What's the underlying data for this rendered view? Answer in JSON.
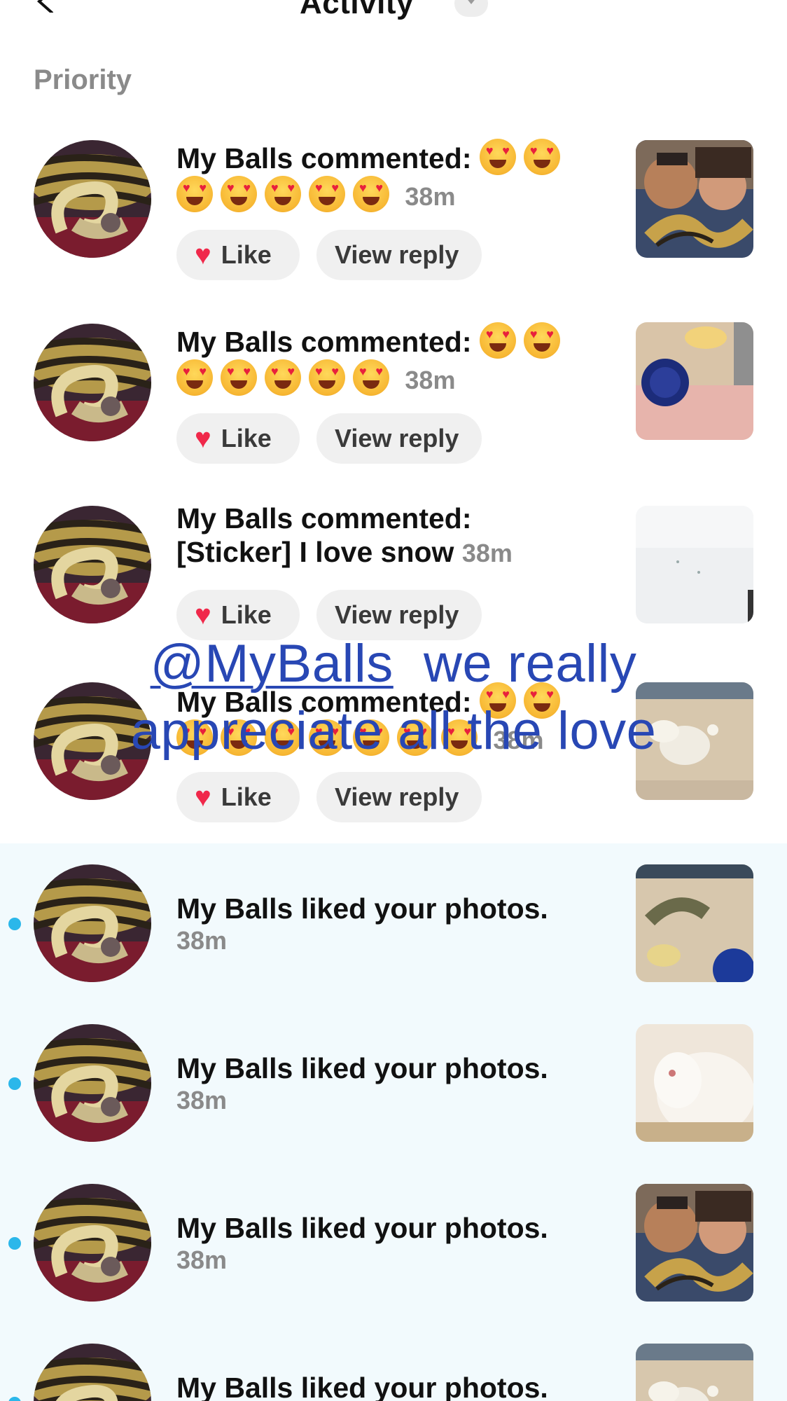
{
  "header": {
    "title": "Activity"
  },
  "section": {
    "label": "Priority"
  },
  "comments": [
    {
      "author": "My Balls",
      "prefix": "My Balls commented:",
      "emoji_count_line1": 2,
      "emoji_count_line2": 5,
      "time": "38m",
      "like_label": "Like",
      "reply_label": "View reply"
    },
    {
      "author": "My Balls",
      "prefix": "My Balls commented:",
      "emoji_count_line1": 2,
      "emoji_count_line2": 5,
      "time": "38m",
      "like_label": "Like",
      "reply_label": "View reply"
    },
    {
      "author": "My Balls",
      "prefix": "My Balls commented:",
      "text": "[Sticker] I love snow",
      "time": "38m",
      "like_label": "Like",
      "reply_label": "View reply"
    },
    {
      "author": "My Balls",
      "prefix": "My Balls commented:",
      "emoji_count_line1": 2,
      "emoji_count_line2": 7,
      "time": "38m",
      "like_label": "Like",
      "reply_label": "View reply"
    }
  ],
  "likes": [
    {
      "text": "My Balls liked your photos.",
      "time": "38m"
    },
    {
      "text": "My Balls liked your photos.",
      "time": "38m"
    },
    {
      "text": "My Balls liked your photos.",
      "time": "38m"
    },
    {
      "text": "My Balls liked your photos.",
      "time": ""
    }
  ],
  "overlay": {
    "mention": "@MyBalls",
    "line1_rest": "  we really",
    "line2": "appreciate all the love"
  },
  "icons": {
    "back": "chevron-left-icon",
    "dropdown": "chevron-down-icon",
    "heart": "heart-icon",
    "emoji": "heart-eyes-emoji"
  },
  "colors": {
    "unread_dot": "#2bb7ea",
    "unread_bg": "#f2fafd",
    "heart": "#f0284a",
    "overlay_text": "#2847b4"
  }
}
